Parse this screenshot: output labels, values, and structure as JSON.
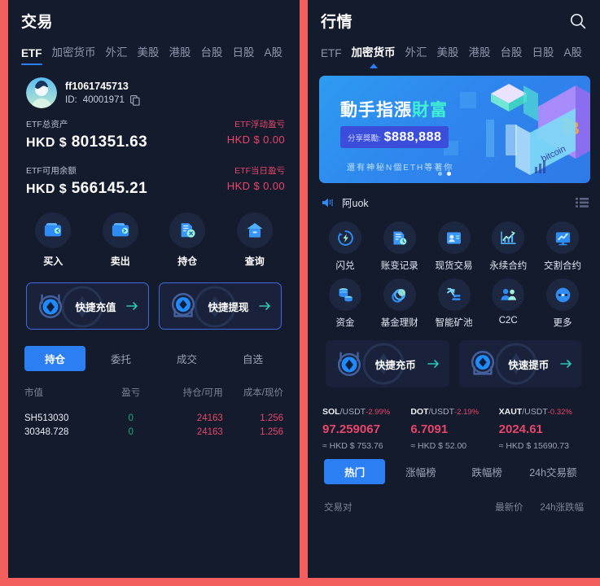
{
  "colors": {
    "frame": "#f25f5c",
    "panel_bg": "#141b2d",
    "accent_blue": "#2b7ff2",
    "down_red": "#e8456b",
    "up_green": "#1aa97b",
    "muted": "#8e98ad"
  },
  "left": {
    "header": {
      "title": "交易"
    },
    "tabs": [
      {
        "label": "ETF",
        "active": true
      },
      {
        "label": "加密货币",
        "active": false
      },
      {
        "label": "外汇",
        "active": false
      },
      {
        "label": "美股",
        "active": false
      },
      {
        "label": "港股",
        "active": false
      },
      {
        "label": "台股",
        "active": false
      },
      {
        "label": "日股",
        "active": false
      },
      {
        "label": "A股",
        "active": false
      }
    ],
    "profile": {
      "name": "ff1061745713",
      "id_label": "ID:",
      "id_value": "40001971",
      "copy_icon": "copy-icon",
      "avatar_icon": "avatar"
    },
    "assets": [
      {
        "label": "ETF总资产",
        "currency": "HKD $",
        "value": "801351.63",
        "right_label": "ETF浮动盈亏",
        "right_currency": "HKD $",
        "right_value": "0.00"
      },
      {
        "label": "ETF可用余额",
        "currency": "HKD $",
        "value": "566145.21",
        "right_label": "ETF当日盈亏",
        "right_currency": "HKD $",
        "right_value": "0.00"
      }
    ],
    "actions": [
      {
        "label": "买入",
        "icon": "wallet-in-icon"
      },
      {
        "label": "卖出",
        "icon": "wallet-out-icon"
      },
      {
        "label": "持仓",
        "icon": "document-cancel-icon"
      },
      {
        "label": "查询",
        "icon": "bank-icon"
      }
    ],
    "quick_cards": [
      {
        "label": "快捷充值",
        "icon": "eth-coin-icon",
        "arrow": "arrow-right-icon"
      },
      {
        "label": "快捷提现",
        "icon": "eth-coin-icon",
        "arrow": "arrow-right-icon"
      }
    ],
    "segments": [
      {
        "label": "持仓",
        "active": true
      },
      {
        "label": "委托",
        "active": false
      },
      {
        "label": "成交",
        "active": false
      },
      {
        "label": "自选",
        "active": false
      }
    ],
    "table": {
      "headers": [
        "市值",
        "盈亏",
        "持仓/可用",
        "成本/现价"
      ],
      "rows": [
        {
          "c0": "SH513030",
          "c1": "0",
          "c2": "24163",
          "c3": "1.256"
        },
        {
          "c0": "30348.728",
          "c1": "0",
          "c2": "24163",
          "c3": "1.256"
        }
      ]
    }
  },
  "right": {
    "header": {
      "title": "行情",
      "search_icon": "search-icon"
    },
    "tabs": [
      {
        "label": "ETF",
        "active": false
      },
      {
        "label": "加密货币",
        "active": true
      },
      {
        "label": "外汇",
        "active": false
      },
      {
        "label": "美股",
        "active": false
      },
      {
        "label": "港股",
        "active": false
      },
      {
        "label": "台股",
        "active": false
      },
      {
        "label": "日股",
        "active": false
      },
      {
        "label": "A股",
        "active": false
      }
    ],
    "banner": {
      "headline_plain": "動手指漲",
      "headline_highlight": "財富",
      "pill_label": "分享獎勵:",
      "pill_amount": "$888,888",
      "subtext": "還有神秘N個ETH等著你",
      "dots": 2,
      "active_dot": 2
    },
    "notice": {
      "speaker_icon": "speaker-icon",
      "text": "阿uok",
      "list_icon": "list-icon"
    },
    "grid": [
      {
        "label": "闪兑",
        "icon": "flash-swap-icon"
      },
      {
        "label": "账变记录",
        "icon": "account-history-icon"
      },
      {
        "label": "现货交易",
        "icon": "spot-trade-icon"
      },
      {
        "label": "永续合约",
        "icon": "perpetual-chart-icon"
      },
      {
        "label": "交割合约",
        "icon": "futures-chart-icon"
      },
      {
        "label": "资金",
        "icon": "funds-coins-icon"
      },
      {
        "label": "基金理财",
        "icon": "fund-stack-icon"
      },
      {
        "label": "智能矿池",
        "icon": "mining-pool-icon"
      },
      {
        "label": "C2C",
        "icon": "people-icon"
      },
      {
        "label": "更多",
        "icon": "more-dots-icon"
      }
    ],
    "quick_cards": [
      {
        "label": "快捷充币",
        "icon": "eth-coin-icon",
        "arrow": "arrow-right-icon"
      },
      {
        "label": "快速提币",
        "icon": "eth-coin-icon",
        "arrow": "arrow-right-icon"
      }
    ],
    "tickers": [
      {
        "base": "SOL",
        "quote": "/USDT",
        "change": "-2.99%",
        "price": "97.259067",
        "fiat": "≈ HKD $ 753.76"
      },
      {
        "base": "DOT",
        "quote": "/USDT",
        "change": "-2.19%",
        "price": "6.7091",
        "fiat": "≈ HKD $ 52.00"
      },
      {
        "base": "XAUT",
        "quote": "/USDT",
        "change": "-0.32%",
        "price": "2024.61",
        "fiat": "≈ HKD $ 15690.73"
      }
    ],
    "segments": [
      {
        "label": "热门",
        "active": true
      },
      {
        "label": "涨幅榜",
        "active": false
      },
      {
        "label": "跌幅榜",
        "active": false
      },
      {
        "label": "24h交易额",
        "active": false
      }
    ],
    "table": {
      "headers": [
        "交易对",
        "最新价",
        "24h涨跌幅"
      ]
    }
  }
}
